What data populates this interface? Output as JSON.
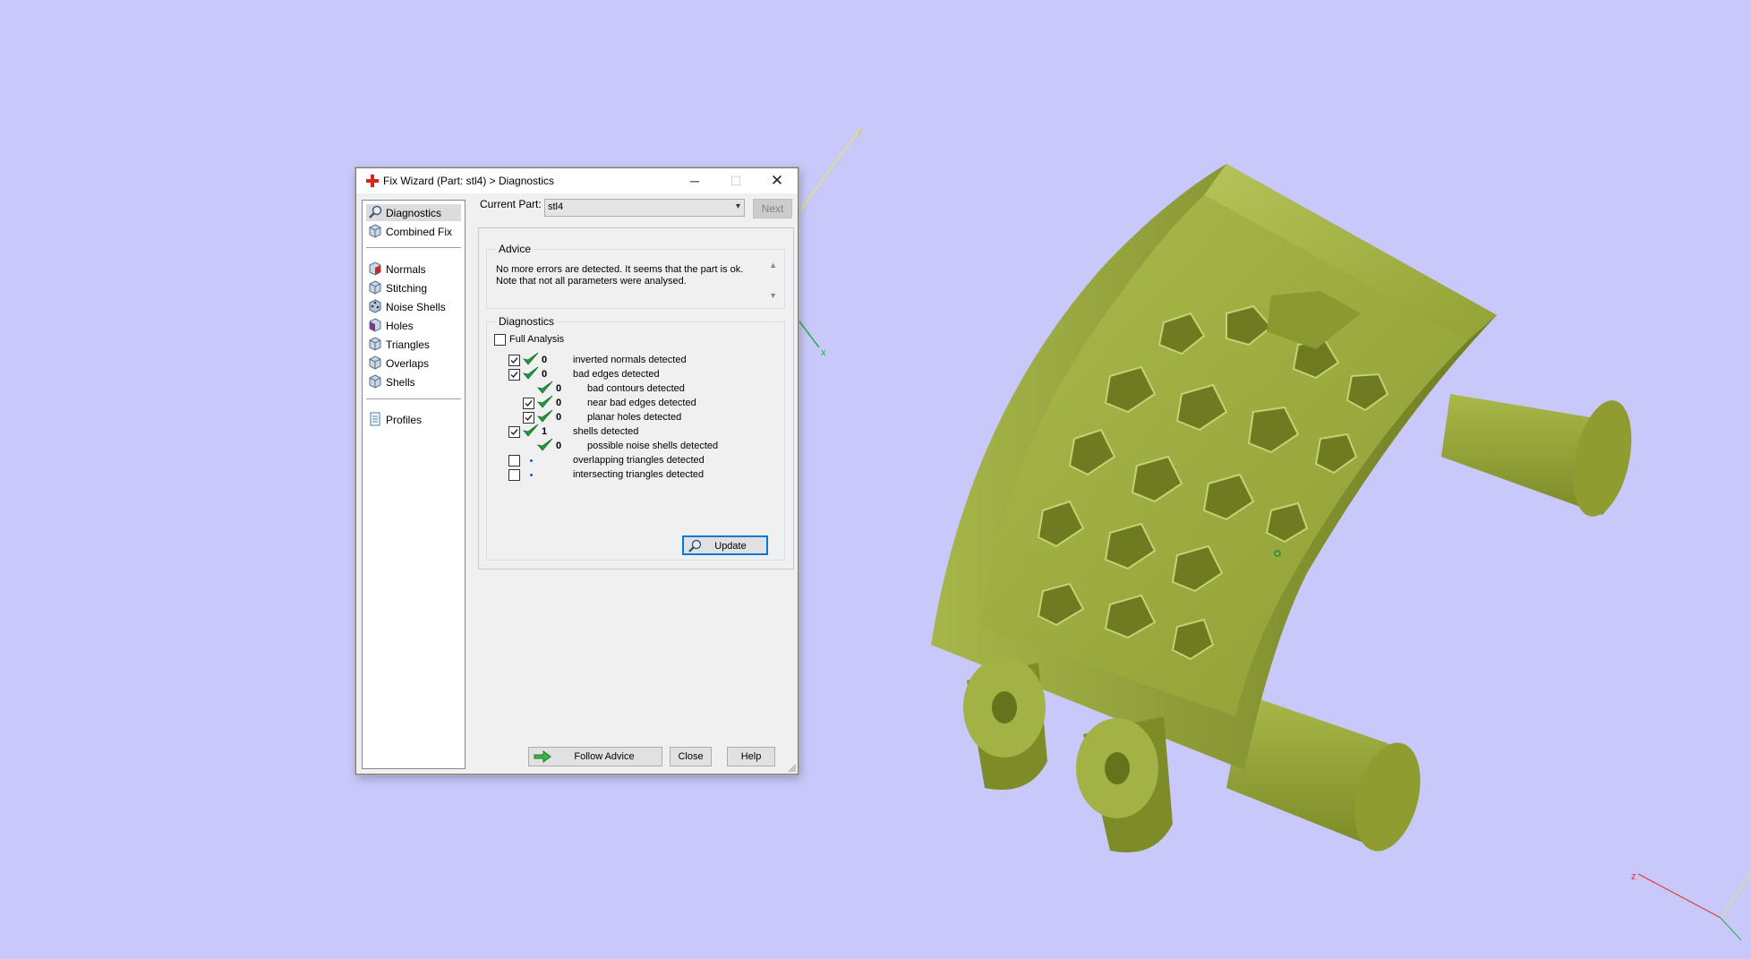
{
  "window": {
    "title": "Fix Wizard (Part: stl4) > Diagnostics",
    "minimize_glyph": "─",
    "maximize_glyph": "☐",
    "close_glyph": "✕"
  },
  "sidebar": {
    "items": [
      {
        "label": "Diagnostics",
        "icon": "magnifier-icon",
        "selected": true
      },
      {
        "label": "Combined Fix",
        "icon": "cube-icon"
      },
      {
        "label": "Normals",
        "icon": "red-cube-icon"
      },
      {
        "label": "Stitching",
        "icon": "cube-icon"
      },
      {
        "label": "Noise Shells",
        "icon": "dotted-cube-icon"
      },
      {
        "label": "Holes",
        "icon": "purple-cube-icon"
      },
      {
        "label": "Triangles",
        "icon": "cube-icon"
      },
      {
        "label": "Overlaps",
        "icon": "cube-icon"
      },
      {
        "label": "Shells",
        "icon": "cube-icon"
      },
      {
        "label": "Profiles",
        "icon": "document-icon"
      }
    ]
  },
  "current_part": {
    "label": "Current Part:",
    "value": "stl4",
    "next_label": "Next"
  },
  "advice": {
    "title": "Advice",
    "text": "No more errors are detected. It seems that the part is ok. Note that not all parameters were analysed."
  },
  "diagnostics": {
    "title": "Diagnostics",
    "full_analysis_label": "Full Analysis",
    "full_analysis_checked": false,
    "rows": [
      {
        "checkbox": true,
        "checked": true,
        "status": "ok",
        "count": "0",
        "label": "inverted normals detected",
        "indent": 0
      },
      {
        "checkbox": true,
        "checked": true,
        "status": "ok",
        "count": "0",
        "label": "bad edges detected",
        "indent": 0
      },
      {
        "checkbox": false,
        "checked": false,
        "status": "ok",
        "count": "0",
        "label": "bad contours detected",
        "indent": 1
      },
      {
        "checkbox": true,
        "checked": true,
        "status": "ok",
        "count": "0",
        "label": "near bad edges detected",
        "indent": 1
      },
      {
        "checkbox": true,
        "checked": true,
        "status": "ok",
        "count": "0",
        "label": "planar holes detected",
        "indent": 1
      },
      {
        "checkbox": true,
        "checked": true,
        "status": "ok",
        "count": "1",
        "label": "shells detected",
        "indent": 0
      },
      {
        "checkbox": false,
        "checked": false,
        "status": "ok",
        "count": "0",
        "label": "possible noise shells detected",
        "indent": 1
      },
      {
        "checkbox": true,
        "checked": false,
        "status": "dot",
        "count": "",
        "label": "overlapping triangles detected",
        "indent": 0
      },
      {
        "checkbox": true,
        "checked": false,
        "status": "dot",
        "count": "",
        "label": "intersecting triangles detected",
        "indent": 0
      }
    ],
    "update_label": "Update"
  },
  "footer": {
    "follow_advice_label": "Follow Advice",
    "close_label": "Close",
    "help_label": "Help"
  },
  "viewport": {
    "background": "#c8c8fa",
    "model_color": "#9aaa3c",
    "axis_labels": {
      "x": "x",
      "y": "y",
      "z": "z"
    }
  }
}
